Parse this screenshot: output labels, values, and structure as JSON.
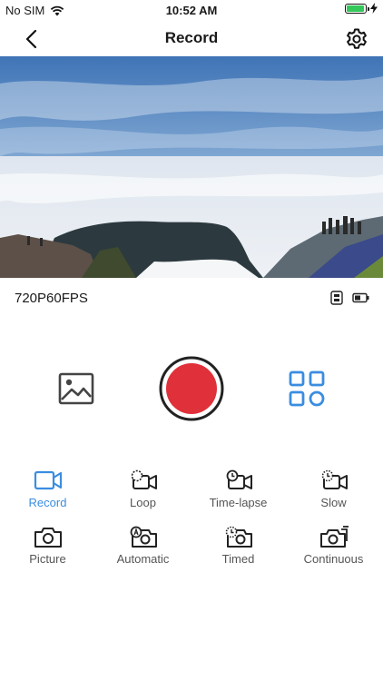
{
  "status": {
    "carrier": "No SIM",
    "time": "10:52 AM"
  },
  "nav": {
    "title": "Record"
  },
  "preview": {
    "image_name": "camera-live-preview"
  },
  "info": {
    "resolution": "720P60FPS"
  },
  "colors": {
    "accent": "#3a8de0",
    "record": "#e0303a",
    "battery": "#34c759"
  },
  "modes": [
    {
      "label": "Record",
      "icon": "video-icon",
      "active": true
    },
    {
      "label": "Loop",
      "icon": "loop-video-icon",
      "active": false
    },
    {
      "label": "Time-lapse",
      "icon": "timelapse-video-icon",
      "active": false
    },
    {
      "label": "Slow",
      "icon": "slow-video-icon",
      "active": false
    },
    {
      "label": "Picture",
      "icon": "camera-icon",
      "active": false
    },
    {
      "label": "Automatic",
      "icon": "auto-camera-icon",
      "active": false
    },
    {
      "label": "Timed",
      "icon": "timer-camera-icon",
      "active": false
    },
    {
      "label": "Continuous",
      "icon": "burst-camera-icon",
      "active": false
    }
  ]
}
